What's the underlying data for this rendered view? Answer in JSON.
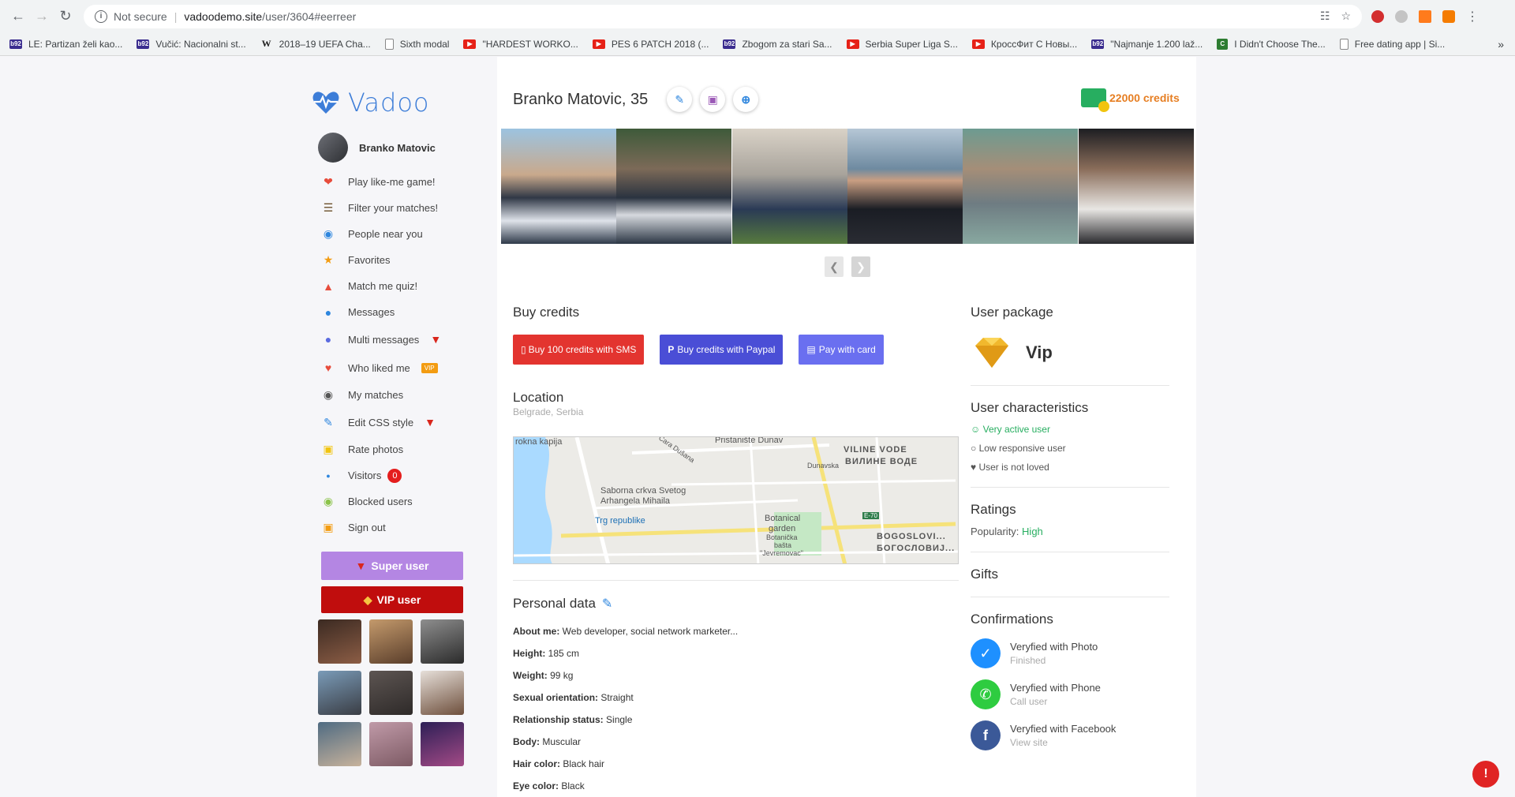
{
  "browser": {
    "security_label": "Not secure",
    "url_host": "vadoodemo.site",
    "url_path": "/user/3604#eerreer",
    "bookmarks": [
      "LE: Partizan želi kao...",
      "Vučić: Nacionalni st...",
      "2018–19 UEFA Cha...",
      "Sixth modal",
      "\"HARDEST WORKO...",
      "PES 6 PATCH 2018 (...",
      "Zbogom za stari Sa...",
      "Serbia Super Liga S...",
      "КроссФит С Новы...",
      "\"Najmanje 1.200 lаž...",
      "I Didn't Choose The...",
      "Free dating app | Si..."
    ],
    "more": "»"
  },
  "sidebar": {
    "logo": "Vadoo",
    "user_name": "Branko Matovic",
    "menu": [
      {
        "label": "Play like-me game!",
        "icon": "heart-icon"
      },
      {
        "label": "Filter your matches!",
        "icon": "filter-icon"
      },
      {
        "label": "People near you",
        "icon": "location-pin-icon"
      },
      {
        "label": "Favorites",
        "icon": "star-icon"
      },
      {
        "label": "Match me quiz!",
        "icon": "fire-icon"
      },
      {
        "label": "Messages",
        "icon": "messenger-icon"
      },
      {
        "label": "Multi messages",
        "icon": "chat-bubbles-icon"
      },
      {
        "label": "Who liked me",
        "icon": "liked-heart-icon"
      },
      {
        "label": "My matches",
        "icon": "matches-icon"
      },
      {
        "label": "Edit CSS style",
        "icon": "paint-brush-icon"
      },
      {
        "label": "Rate photos",
        "icon": "rate-photos-icon"
      },
      {
        "label": "Visitors",
        "icon": "visitors-icon"
      },
      {
        "label": "Blocked users",
        "icon": "blocked-icon"
      },
      {
        "label": "Sign out",
        "icon": "lock-icon"
      }
    ],
    "who_liked_badge": "VIP",
    "visitors_count": "0",
    "super_user_label": "Super user",
    "vip_user_label": "VIP user"
  },
  "profile": {
    "title": "Branko Matovic, 35",
    "credits": "22000 credits"
  },
  "buy_credits": {
    "title": "Buy credits",
    "sms_label": "Buy 100 credits with SMS",
    "paypal_label": "Buy credits with Paypal",
    "card_label": "Pay with card"
  },
  "location": {
    "title": "Location",
    "place": "Belgrade, Serbia",
    "map_labels": [
      "VILINE VODE",
      "ВИЛИНЕ ВОДЕ",
      "Saborna crkva Svetog",
      "Arhangela Mihaila",
      "Trg republike",
      "Botanical",
      "garden",
      "Botanička",
      "bašta",
      "\"Jevremovac\"",
      "BOGOSLOVI...",
      "БОГОСЛОВИЈ...",
      "Cara Dušana",
      "E-70",
      "Dunavska",
      "Pristanište Dunav",
      "rokna kapija"
    ]
  },
  "personal_data": {
    "title": "Personal data",
    "rows": [
      {
        "label": "About me:",
        "value": "Web developer, social network marketer..."
      },
      {
        "label": "Height:",
        "value": "185 cm"
      },
      {
        "label": "Weight:",
        "value": "99 kg"
      },
      {
        "label": "Sexual orientation:",
        "value": "Straight"
      },
      {
        "label": "Relationship status:",
        "value": "Single"
      },
      {
        "label": "Body:",
        "value": "Muscular"
      },
      {
        "label": "Hair color:",
        "value": "Black hair"
      },
      {
        "label": "Eye color:",
        "value": "Black"
      }
    ]
  },
  "user_package": {
    "title": "User package",
    "name": "Vip"
  },
  "characteristics": {
    "title": "User characteristics",
    "items": [
      "Very active user",
      "Low responsive user",
      "User is not loved"
    ]
  },
  "ratings": {
    "title": "Ratings",
    "popularity_label": "Popularity:",
    "popularity_value": "High"
  },
  "gifts": {
    "title": "Gifts"
  },
  "confirmations": {
    "title": "Confirmations",
    "items": [
      {
        "title": "Veryfied with Photo",
        "sub": "Finished"
      },
      {
        "title": "Veryfied with Phone",
        "sub": "Call user"
      },
      {
        "title": "Veryfied with Facebook",
        "sub": "View site"
      }
    ]
  },
  "alert_mark": "!"
}
